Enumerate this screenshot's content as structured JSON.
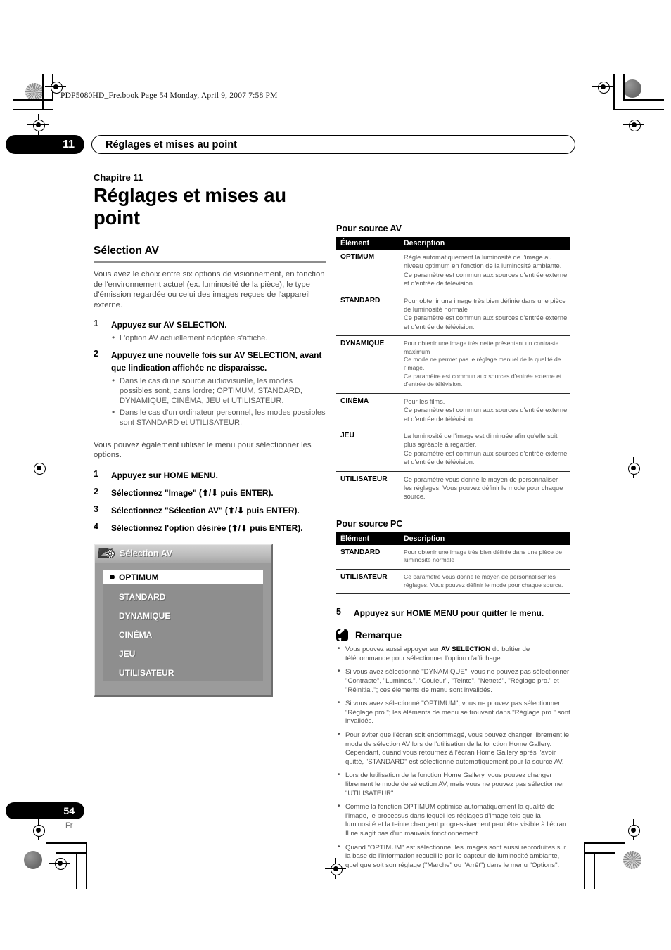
{
  "print_marks": {
    "file_slug": "PDP5080HD_Fre.book  Page 54  Monday, April 9, 2007  7:58 PM"
  },
  "running_head": {
    "chapter_number": "11",
    "title": "Réglages et mises au point"
  },
  "left_column": {
    "chapter_label": "Chapitre 11",
    "chapter_title": "Réglages et mises au point",
    "section_title": "Sélection AV",
    "intro": "Vous avez le choix entre six options de visionnement, en fonction de l'environnement actuel (ex. luminosité de la pièce), le type d'émission regardée ou celui des images reçues de l'appareil externe.",
    "steps_a": [
      {
        "num": "1",
        "text": "Appuyez sur AV SELECTION.",
        "bullets": [
          "L'option AV actuellement adoptée s'affiche."
        ]
      },
      {
        "num": "2",
        "text": "Appuyez une nouvelle fois sur AV SELECTION, avant que lindication affichée ne disparaisse.",
        "bullets": [
          "Dans le cas dune source audiovisuelle, les modes possibles sont, dans lordre; OPTIMUM, STANDARD, DYNAMIQUE, CINÉMA, JEU et UTILISATEUR.",
          "Dans le cas d'un ordinateur personnel, les modes possibles sont STANDARD et UTILISATEUR."
        ]
      }
    ],
    "menu_intro": "Vous pouvez également utiliser le menu pour sélectionner les options.",
    "steps_b": [
      {
        "num": "1",
        "text": "Appuyez sur HOME MENU."
      },
      {
        "num": "2",
        "text": "Sélectionnez \"Image\" (⬆/⬇ puis ENTER)."
      },
      {
        "num": "3",
        "text": "Sélectionnez \"Sélection AV\" (⬆/⬇ puis ENTER)."
      },
      {
        "num": "4",
        "text": "Sélectionnez l'option désirée (⬆/⬇ puis ENTER)."
      }
    ]
  },
  "osd": {
    "title": "Sélection AV",
    "icon": "tv-gear-icon",
    "items": [
      {
        "label": "OPTIMUM",
        "selected": true
      },
      {
        "label": "STANDARD",
        "selected": false
      },
      {
        "label": "DYNAMIQUE",
        "selected": false
      },
      {
        "label": "CINÉMA",
        "selected": false
      },
      {
        "label": "JEU",
        "selected": false
      },
      {
        "label": "UTILISATEUR",
        "selected": false
      }
    ]
  },
  "right_column": {
    "av_table": {
      "caption": "Pour source AV",
      "headers": {
        "item": "Élément",
        "description": "Description"
      },
      "rows": [
        {
          "item": "OPTIMUM",
          "description": "Règle automatiquement la luminosité de l'image au niveau optimum en fonction de la luminosité ambiante.\nCe paramètre est commun aux sources d'entrée externe et d'entrée de télévision."
        },
        {
          "item": "STANDARD",
          "description": "Pour obtenir une image très bien définie dans une pièce de luminosité normale\nCe paramètre est commun aux sources d'entrée externe et d'entrée de télévision."
        },
        {
          "item": "DYNAMIQUE",
          "description": "Pour obtenir une image très nette présentant un contraste maximum\nCe mode ne permet pas le réglage manuel de la qualité de l'image.\nCe paramètre est commun aux sources d'entrée externe et d'entrée de télévision."
        },
        {
          "item": "CINÉMA",
          "description": "Pour les films.\nCe paramètre est commun aux sources d'entrée externe et d'entrée de télévision."
        },
        {
          "item": "JEU",
          "description": "La luminosité de l'image est diminuée afin qu'elle soit plus agréable à regarder.\nCe paramètre est commun aux sources d'entrée externe et d'entrée de télévision."
        },
        {
          "item": "UTILISATEUR",
          "description": "Ce paramètre vous donne le moyen de personnaliser les réglages. Vous pouvez définir le mode pour chaque source."
        }
      ]
    },
    "pc_table": {
      "caption": "Pour source PC",
      "headers": {
        "item": "Élément",
        "description": "Description"
      },
      "rows": [
        {
          "item": "STANDARD",
          "description": "Pour obtenir une image très bien définie dans une pièce de luminosité normale"
        },
        {
          "item": "UTILISATEUR",
          "description": "Ce paramètre vous donne le moyen de personnaliser les réglages. Vous pouvez définir le mode pour chaque source."
        }
      ]
    },
    "step5": {
      "num": "5",
      "text": "Appuyez sur HOME MENU pour quitter le menu."
    },
    "note": {
      "icon": "pencil-note-icon",
      "title": "Remarque",
      "items": [
        "Vous pouvez aussi appuyer sur AV SELECTION du boîtier de télécommande pour sélectionner l'option d'affichage.",
        "Si vous avez sélectionné \"DYNAMIQUE\", vous ne pouvez pas sélectionner \"Contraste\", \"Luminos.\", \"Couleur\", \"Teinte\", \"Netteté\", \"Réglage pro.\" et \"Réinitial.\"; ces éléments de menu sont invalidés.",
        "Si vous avez sélectionné \"OPTIMUM\", vous ne pouvez pas sélectionner \"Réglage pro.\"; les éléments de menu se trouvant dans \"Réglage pro.\" sont invalidés.",
        "Pour éviter que l'écran soit endommagé, vous pouvez changer librement le mode de sélection AV lors de l'utilisation de la fonction Home Gallery. Cependant, quand vous retournez à l'écran Home Gallery après l'avoir quitté, \"STANDARD\" est sélectionné automatiquement pour la source AV.",
        "Lors de lutilisation de la fonction Home Gallery, vous pouvez changer librement le mode de sélection AV, mais vous ne pouvez pas sélectionner \"UTILISATEUR\".",
        "Comme la fonction OPTIMUM optimise automatiquement la qualité de l'image, le processus dans lequel les réglages d'image tels que la luminosité et la teinte changent progressivement peut être visible à l'écran. Il ne s'agit pas d'un mauvais fonctionnement.",
        "Quand \"OPTIMUM\" est sélectionné, les images sont aussi reproduites sur la base de l'information recueillie par le capteur de luminosité ambiante, quel que soit son réglage (\"Marche\" ou \"Arrêt\") dans le menu \"Options\"."
      ],
      "bold_fragment": "AV SELECTION"
    }
  },
  "footer": {
    "page_number": "54",
    "language": "Fr"
  }
}
